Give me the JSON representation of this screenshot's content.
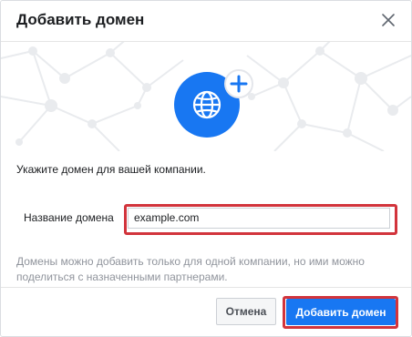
{
  "dialog": {
    "title": "Добавить домен",
    "instruction": "Укажите домен для вашей компании.",
    "field_label": "Название домена",
    "domain_value": "example.com",
    "note": "Домены можно добавить только для одной компании, но ими можно поделиться с назначенными партнерами.",
    "cancel_label": "Отмена",
    "submit_label": "Добавить домен"
  },
  "icons": {
    "close": "close-icon",
    "globe": "globe-icon",
    "plus": "plus-icon"
  },
  "colors": {
    "primary": "#1877f2",
    "highlight": "#d2343c",
    "muted_text": "#90949c"
  }
}
